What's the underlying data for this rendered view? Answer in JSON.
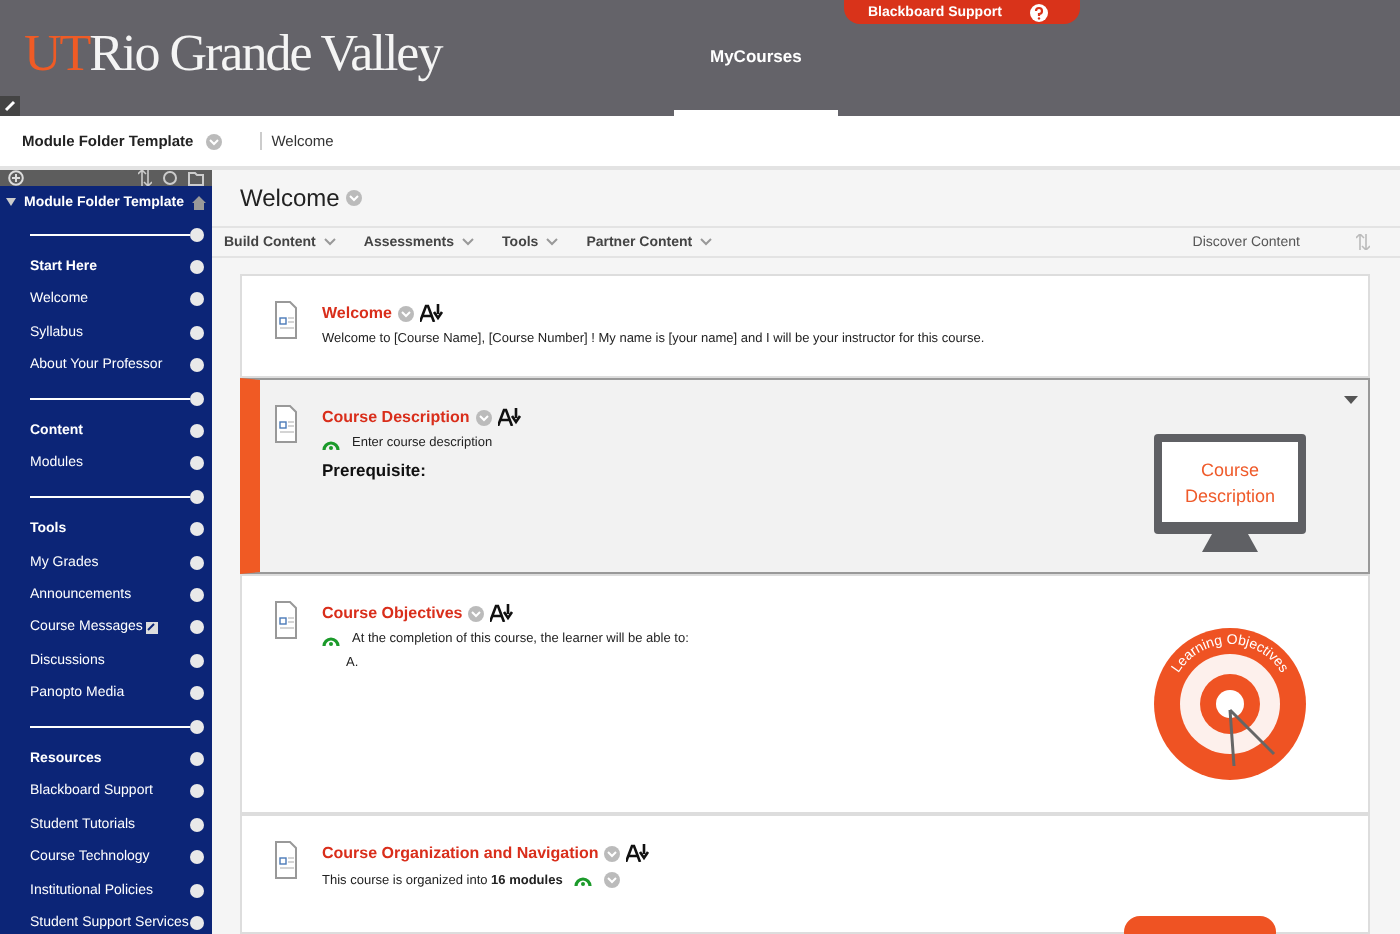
{
  "header": {
    "logo_mark": "UT",
    "logo_name": "Rio Grande Valley",
    "support_button": "Blackboard Support",
    "tabs": [
      {
        "label": "MyCourses",
        "selected": true
      }
    ]
  },
  "breadcrumb": {
    "course": "Module Folder Template",
    "page": "Welcome"
  },
  "sidebar": {
    "title": "Module Folder Template",
    "items": [
      {
        "kind": "divider"
      },
      {
        "kind": "heading",
        "label": "Start Here"
      },
      {
        "kind": "link",
        "label": "Welcome",
        "new_mark": false
      },
      {
        "kind": "link",
        "label": "Syllabus",
        "new_mark": false
      },
      {
        "kind": "link",
        "label": "About Your Professor",
        "new_mark": false
      },
      {
        "kind": "divider"
      },
      {
        "kind": "heading",
        "label": "Content"
      },
      {
        "kind": "link",
        "label": "Modules",
        "new_mark": false
      },
      {
        "kind": "divider"
      },
      {
        "kind": "heading",
        "label": "Tools"
      },
      {
        "kind": "link",
        "label": "My Grades",
        "new_mark": false
      },
      {
        "kind": "link",
        "label": "Announcements",
        "new_mark": false
      },
      {
        "kind": "link",
        "label": "Course Messages",
        "new_mark": true
      },
      {
        "kind": "link",
        "label": "Discussions",
        "new_mark": false
      },
      {
        "kind": "link",
        "label": "Panopto Media",
        "new_mark": false
      },
      {
        "kind": "divider"
      },
      {
        "kind": "heading",
        "label": "Resources"
      },
      {
        "kind": "link",
        "label": "Blackboard Support",
        "new_mark": false
      },
      {
        "kind": "link",
        "label": "Student Tutorials",
        "new_mark": false
      },
      {
        "kind": "link",
        "label": "Course Technology",
        "new_mark": false
      },
      {
        "kind": "link",
        "label": "Institutional Policies",
        "new_mark": false
      },
      {
        "kind": "link",
        "label": "Student Support Services",
        "new_mark": false
      }
    ]
  },
  "page_title": "Welcome",
  "toolbar": {
    "menus": [
      "Build Content",
      "Assessments",
      "Tools",
      "Partner Content"
    ],
    "discover": "Discover Content"
  },
  "cards": [
    {
      "title": "Welcome",
      "selected": false,
      "lines": [
        {
          "kind": "plain",
          "text": "Welcome to [Course Name], [Course Number] ! My name is [your name] and I will be your instructor for this course."
        }
      ]
    },
    {
      "title": "Course Description",
      "selected": true,
      "graphic": {
        "kind": "monitor",
        "text": "Course Description"
      },
      "lines": [
        {
          "kind": "status",
          "text": "Enter course description"
        },
        {
          "kind": "bold",
          "text": "Prerequisite:"
        }
      ]
    },
    {
      "title": "Course Objectives",
      "selected": false,
      "graphic": {
        "kind": "target",
        "text": "Learning Objectives"
      },
      "lines": [
        {
          "kind": "status",
          "text": "At the completion of this course, the learner will be able to:"
        },
        {
          "kind": "indent",
          "text": "A."
        }
      ]
    },
    {
      "title": "Course Organization and Navigation",
      "selected": false,
      "graphic": {
        "kind": "button"
      },
      "lines": [
        {
          "kind": "plain_icons",
          "text": "This course is organized into **16 modules**"
        }
      ]
    }
  ]
}
